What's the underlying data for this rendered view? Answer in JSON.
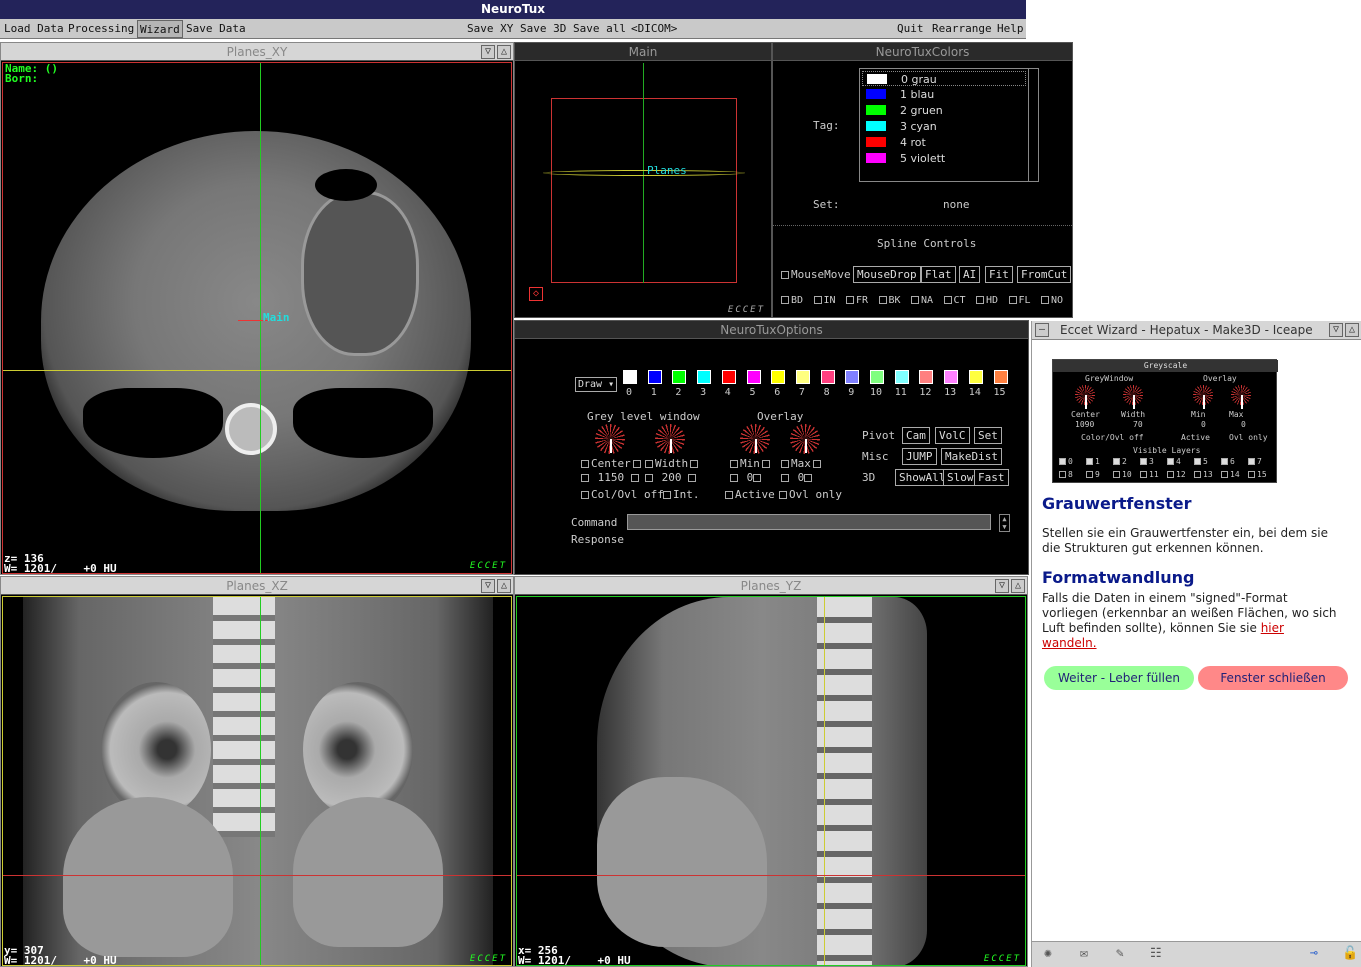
{
  "app_title": "NeuroTux",
  "menu_left": [
    "Load Data",
    "Processing",
    "Wizard",
    "Save Data"
  ],
  "menu_mid": [
    "Save XY",
    "Save 3D",
    "Save all",
    "<DICOM>"
  ],
  "menu_right": [
    "Quit",
    "Rearrange",
    "Help"
  ],
  "win_xy": {
    "title": "Planes_XY",
    "name": "Name: ()",
    "born": "Born:",
    "main_label": "Main",
    "z": "z= 136",
    "w": "W= 1201/    +0 HU"
  },
  "win_xz": {
    "title": "Planes_XZ",
    "y": "y= 307",
    "w": "W= 1201/    +0 HU"
  },
  "win_yz": {
    "title": "Planes_YZ",
    "x": "x= 256",
    "w": "W= 1201/    +0 HU"
  },
  "ecc": "ECCET",
  "win_main": {
    "title": "Main",
    "label": "Planes"
  },
  "win_colors": {
    "title": "NeuroTuxColors",
    "tag_label": "Tag:",
    "set_label": "Set:",
    "set_value": "none",
    "colors": [
      {
        "name": "0 grau",
        "hex": "#ffffff"
      },
      {
        "name": "1 blau",
        "hex": "#0000ff"
      },
      {
        "name": "2 gruen",
        "hex": "#00ff00"
      },
      {
        "name": "3 cyan",
        "hex": "#00ffff"
      },
      {
        "name": "4 rot",
        "hex": "#ff0000"
      },
      {
        "name": "5 violett",
        "hex": "#ff00ff"
      }
    ],
    "spline_title": "Spline Controls",
    "spline_mousemove": "MouseMove",
    "spline_buttons": [
      "MouseDrop",
      "Flat",
      "AI",
      "Fit",
      "FromCut"
    ],
    "spline_checks": [
      "BD",
      "IN",
      "FR",
      "BK",
      "NA",
      "CT",
      "HD",
      "FL",
      "NO"
    ]
  },
  "win_options": {
    "title": "NeuroTuxOptions",
    "draw": "Draw",
    "swatches": [
      "#ffffff",
      "#0000ff",
      "#00ff00",
      "#00ffff",
      "#ff0000",
      "#ff00ff",
      "#ffff00",
      "#ffff80",
      "#ff4080",
      "#8080ff",
      "#80ff80",
      "#80ffff",
      "#ff8080",
      "#ff80ff",
      "#ffff40",
      "#ff8040"
    ],
    "swatch_nums": [
      "0",
      "1",
      "2",
      "3",
      "4",
      "5",
      "6",
      "7",
      "8",
      "9",
      "10",
      "11",
      "12",
      "13",
      "14",
      "15"
    ],
    "grey_title": "Grey level window",
    "overlay_title": "Overlay",
    "center_label": "Center",
    "width_label": "Width",
    "center_val": "1150",
    "width_val": "200",
    "min_label": "Min",
    "max_label": "Max",
    "min_val": "0",
    "max_val": "0",
    "colovl": "Col/Ovl off",
    "int": "Int.",
    "active": "Active",
    "ovlonly": "Ovl only",
    "pivot": "Pivot",
    "misc": "Misc",
    "d3": "3D",
    "pivot_btns": [
      "Cam",
      "VolC",
      "Set"
    ],
    "misc_btns": [
      "JUMP",
      "MakeDist"
    ],
    "d3_btns": [
      "ShowAll",
      "Slow",
      "Fast"
    ],
    "command": "Command",
    "response": "Response"
  },
  "wizard": {
    "title": "Eccet Wizard - Hepatux - Make3D - Iceape",
    "thumb_title": "Greyscale",
    "thumb_grey": "GreyWindow",
    "thumb_overlay": "Overlay",
    "thumb_center": "Center",
    "thumb_width": "Width",
    "thumb_min": "Min",
    "thumb_max": "Max",
    "thumb_center_val": "1090",
    "thumb_width_val": "70",
    "thumb_min_val": "0",
    "thumb_max_val": "0",
    "thumb_colovl": "Color/Ovl off",
    "thumb_active": "Active",
    "thumb_ovlonly": "Ovl only",
    "thumb_layers": "Visible Layers",
    "thumb_layer_nums": [
      "0",
      "1",
      "2",
      "3",
      "4",
      "5",
      "6",
      "7",
      "8",
      "9",
      "10",
      "11",
      "12",
      "13",
      "14",
      "15"
    ],
    "h1": "Grauwertfenster",
    "p1": "Stellen sie ein Grauwertfenster ein, bei dem sie die Strukturen gut erkennen können.",
    "h2": "Formatwandlung",
    "p2": "Falls die Daten in einem \"signed\"-Format vorliegen (erkennbar an weißen Flächen, wo sich Luft befinden sollte), können Sie sie",
    "link": "hier wandeln.",
    "btn_next": "Weiter - Leber füllen",
    "btn_close": "Fenster schließen"
  }
}
